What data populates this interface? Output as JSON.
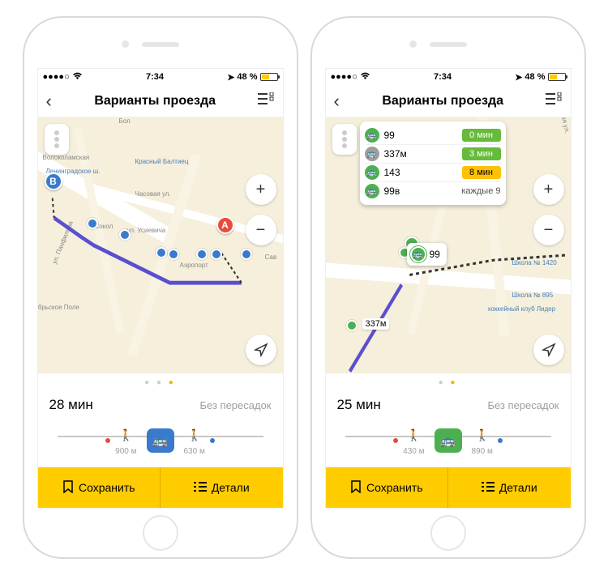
{
  "status": {
    "time": "7:34",
    "battery": "48 %"
  },
  "nav": {
    "title": "Варианты проезда"
  },
  "left": {
    "summary_time": "28 мин",
    "summary_note": "Без пересадок",
    "seg_walk1": "900 м",
    "seg_walk2": "630 м",
    "save": "Сохранить",
    "details": "Детали",
    "marker_a": "A",
    "marker_b": "B",
    "map_labels": {
      "volokolamskaya": "Волоколамская",
      "baltiec": "Красный Балтиец",
      "sokol": "Сокол",
      "leningradskoe": "Ленинградское ш.",
      "chasovaya": "Часовая ул.",
      "usievicha": "ул. Усиевича",
      "aeroport": "Аэропорт",
      "panfilova": "ул. Панфилова",
      "pole": "ябрьское Поле",
      "sav": "Сав",
      "bol": "Бол"
    }
  },
  "right": {
    "summary_time": "25 мин",
    "summary_note": "Без пересадок",
    "seg_walk1": "430 м",
    "seg_walk2": "890 м",
    "save": "Сохранить",
    "details": "Детали",
    "popup": {
      "r1_num": "99",
      "r1_time": "0 мин",
      "r2_num": "337м",
      "r2_time": "3 мин",
      "r3_num": "143",
      "r3_time": "8 мин",
      "r4_num": "99в",
      "r4_time": "каждые 9"
    },
    "mini_popup": "99",
    "distance_label": "337м",
    "map_labels": {
      "school1420": "Школа № 1420",
      "school895": "Школа № 895",
      "club_lider": "хоккейный клуб Лидер",
      "tashkentskaya": "Ташкентская ул."
    }
  }
}
